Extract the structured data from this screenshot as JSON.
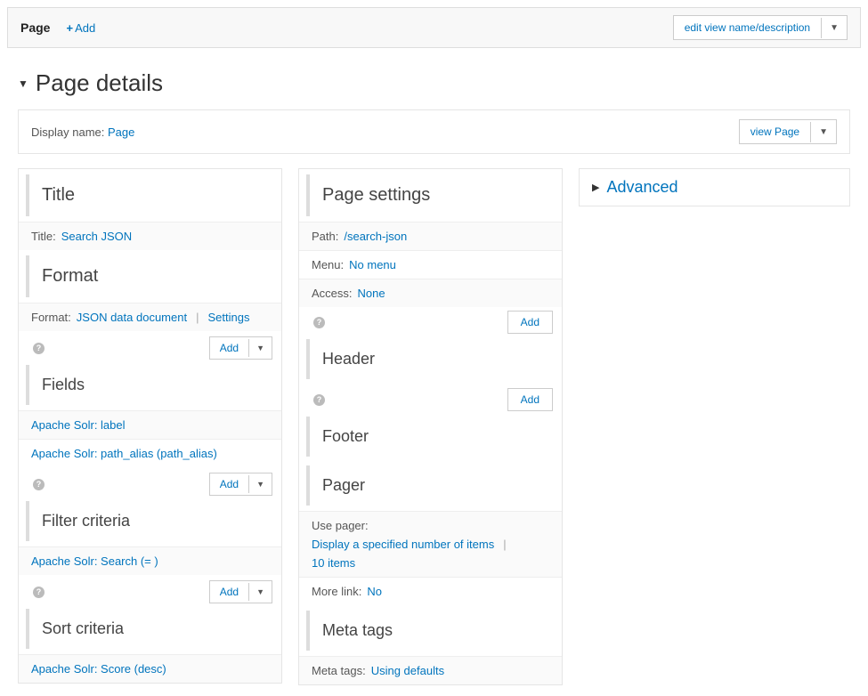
{
  "topbar": {
    "tab_label": "Page",
    "add_label": "Add",
    "edit_view_label": "edit view name/description"
  },
  "page_details": {
    "heading": "Page details",
    "display_name_label": "Display name:",
    "display_name_value": "Page",
    "view_page_label": "view Page"
  },
  "left": {
    "title_heading": "Title",
    "title_label": "Title:",
    "title_value": "Search JSON",
    "format_heading": "Format",
    "format_label": "Format:",
    "format_value": "JSON data document",
    "format_settings": "Settings",
    "fields_heading": "Fields",
    "fields_add": "Add",
    "fields": [
      "Apache Solr: label",
      "Apache Solr: path_alias (path_alias)"
    ],
    "filter_heading": "Filter criteria",
    "filter_add": "Add",
    "filters": [
      "Apache Solr: Search (= )"
    ],
    "sort_heading": "Sort criteria",
    "sort_add": "Add",
    "sorts": [
      "Apache Solr: Score (desc)"
    ]
  },
  "mid": {
    "page_settings_heading": "Page settings",
    "path_label": "Path:",
    "path_value": "/search-json",
    "menu_label": "Menu:",
    "menu_value": "No menu",
    "access_label": "Access:",
    "access_value": "None",
    "header_heading": "Header",
    "header_add": "Add",
    "footer_heading": "Footer",
    "footer_add": "Add",
    "pager_heading": "Pager",
    "use_pager_label": "Use pager:",
    "use_pager_value": "Display a specified number of items",
    "pager_items": "10 items",
    "more_link_label": "More link:",
    "more_link_value": "No",
    "meta_heading": "Meta tags",
    "meta_label": "Meta tags:",
    "meta_value": "Using defaults"
  },
  "right": {
    "advanced_label": "Advanced"
  }
}
